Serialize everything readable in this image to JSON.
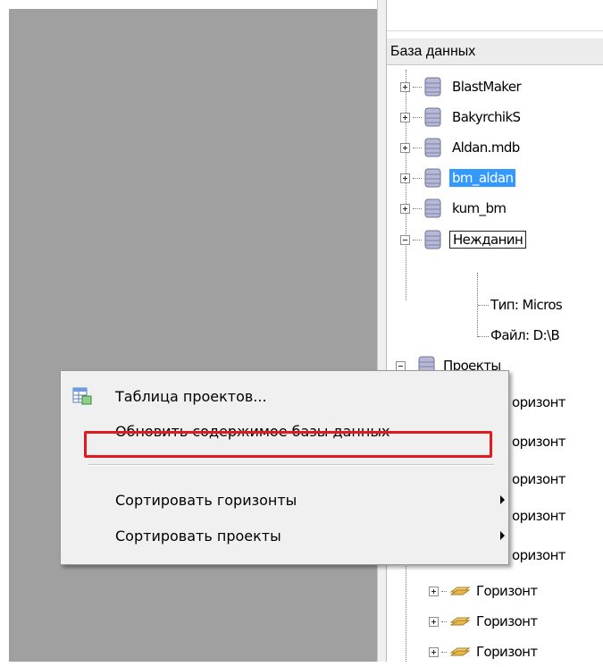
{
  "tree": {
    "header": "База данных",
    "databases": [
      {
        "label": "BlastMaker"
      },
      {
        "label": "BakyrchikS"
      },
      {
        "label": "Aldan.mdb"
      },
      {
        "label": "bm_aldan"
      },
      {
        "label": "kum_bm"
      },
      {
        "label": "Нежданин"
      }
    ],
    "details": [
      {
        "label": "Тип: Micros"
      },
      {
        "label": "Файл: D:\\B"
      }
    ],
    "projects_label": "Проекты",
    "horizons": [
      {
        "label": "оризонт"
      },
      {
        "label": "оризонт"
      },
      {
        "label": "оризонт"
      },
      {
        "label": "оризонт"
      },
      {
        "label": "оризонт"
      },
      {
        "label": "Горизонт"
      },
      {
        "label": "Горизонт"
      },
      {
        "label": "Горизонт"
      }
    ]
  },
  "context_menu": {
    "items": [
      {
        "label": "Таблица проектов..."
      },
      {
        "label": "Обновить содержимое базы данных"
      },
      {
        "label": "Сортировать горизонты"
      },
      {
        "label": "Сортировать проекты"
      }
    ]
  },
  "colors": {
    "selection": "#3399ff",
    "highlight_box": "#e3191f",
    "desktop_gray": "#a0a0a0"
  }
}
